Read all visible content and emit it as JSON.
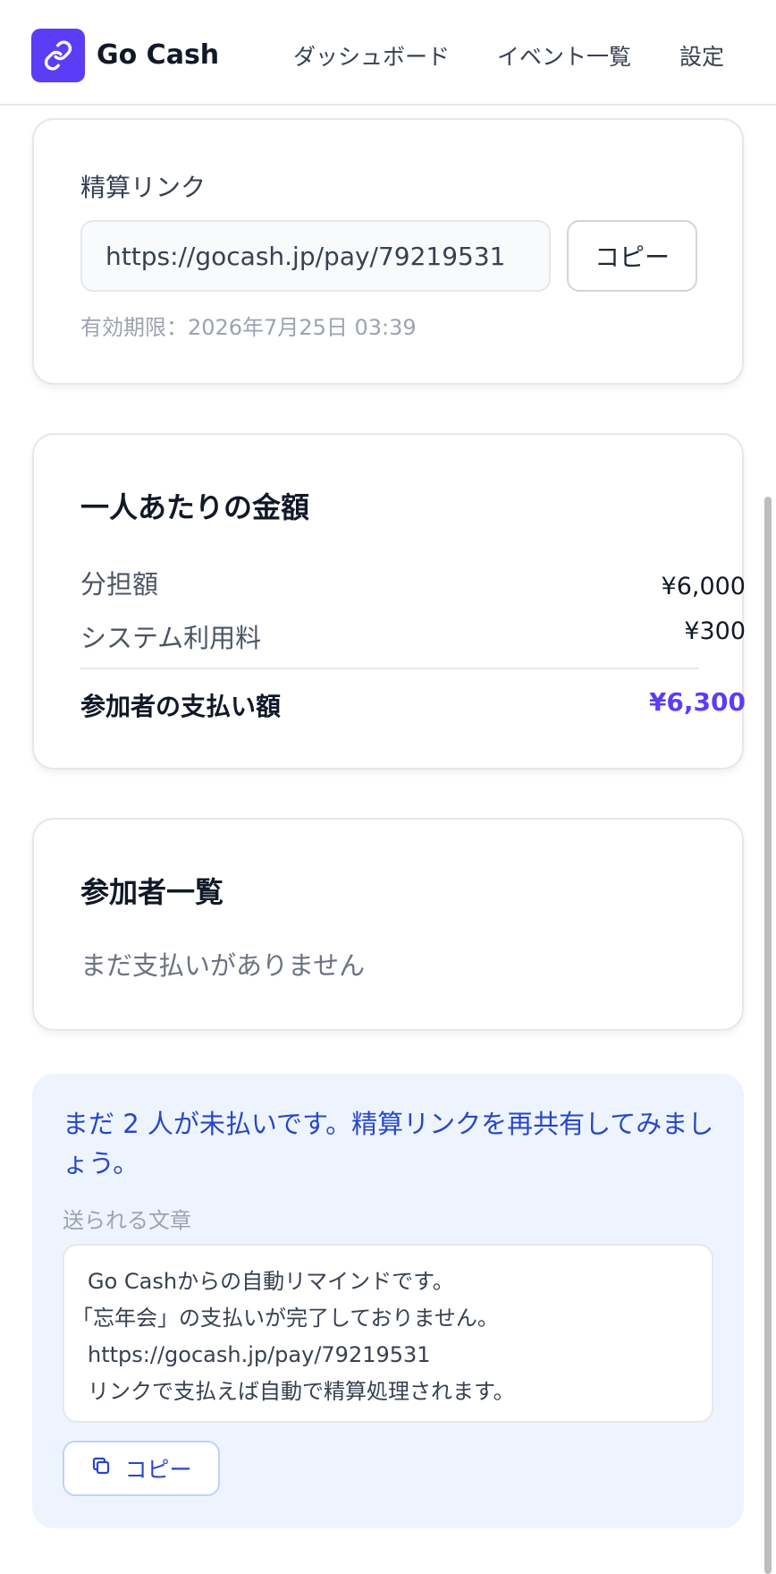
{
  "header": {
    "brand": "Go Cash",
    "logo_icon": "link-icon",
    "nav": [
      "ダッシュボード",
      "イベント一覧",
      "設定"
    ]
  },
  "link_card": {
    "label": "精算リンク",
    "url": "https://gocash.jp/pay/79219531",
    "copy_label": "コピー",
    "expiry": "有効期限：2026年7月25日 03:39"
  },
  "amount_card": {
    "title": "一人あたりの金額",
    "rows": [
      {
        "label": "分担額",
        "value": "¥6,000"
      },
      {
        "label": "システム利用料",
        "value": "¥300"
      }
    ],
    "total_label": "参加者の支払い額",
    "total_value": "¥6,300"
  },
  "participants_card": {
    "title": "参加者一覧",
    "empty": "まだ支払いがありません"
  },
  "reminder": {
    "message": "まだ 2 人が未払いです。精算リンクを再共有してみましょう。",
    "sent_label": "送られる文章",
    "lines": [
      "Go Cashからの自動リマインドです。",
      "「忘年会」の支払いが完了しておりません。",
      "https://gocash.jp/pay/79219531",
      "リンクで支払えば自動で精算処理されます。"
    ],
    "copy_label": "コピー",
    "copy_icon": "copy-icon"
  },
  "colors": {
    "brand": "#5b3df5",
    "reminder_bg": "#eef4fe",
    "reminder_text": "#2747c8"
  }
}
